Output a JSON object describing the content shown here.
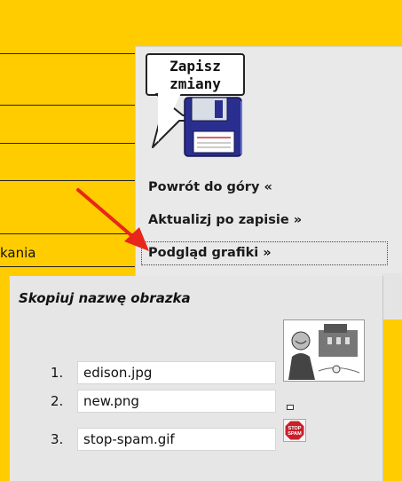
{
  "left": {
    "cut_label": "kania"
  },
  "save_button": {
    "label_line1": "Zapisz",
    "label_line2": "zmiany",
    "icon": "floppy-disk-icon"
  },
  "menu": {
    "items": [
      {
        "label": "Powrót do góry «"
      },
      {
        "label": "Aktualizj po zapisie »"
      },
      {
        "label": "Podgląd grafiki »"
      }
    ]
  },
  "popup": {
    "title": "Skopiuj nazwę obrazka",
    "rows": [
      {
        "num": "1.",
        "value": "edison.jpg"
      },
      {
        "num": "2.",
        "value": "new.png"
      },
      {
        "num": "3.",
        "value": "stop-spam.gif"
      }
    ],
    "thumbnails": [
      {
        "name": "edison-thumbnail"
      },
      {
        "name": "new-thumbnail"
      },
      {
        "name": "stop-spam-thumbnail",
        "sign_text": [
          "STOP",
          "SPAM"
        ]
      }
    ]
  },
  "colors": {
    "page_bg": "#FFCC00",
    "panel_bg": "#E9E9E9",
    "arrow": "#E8261C",
    "stop_sign": "#C8202A"
  }
}
